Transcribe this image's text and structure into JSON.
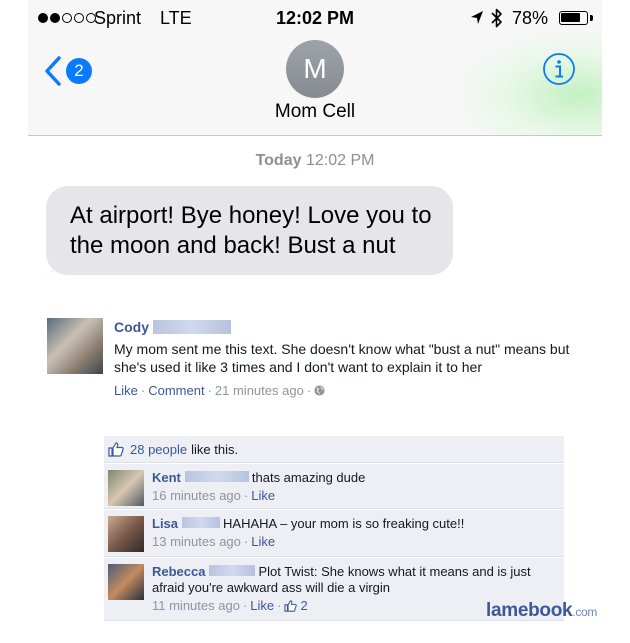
{
  "status_bar": {
    "carrier": "Sprint",
    "network": "LTE",
    "time": "12:02 PM",
    "battery_percent": "78%",
    "battery_level": 0.78,
    "signal_bars_filled": 2,
    "signal_bars_total": 5
  },
  "header": {
    "back_count": "2",
    "contact_initial": "M",
    "contact_name": "Mom Cell",
    "info_icon": "info-icon"
  },
  "thread": {
    "timestamp_day": "Today",
    "timestamp_time": "12:02 PM",
    "message": "At airport! Bye honey! Love you to the moon and back! Bust a nut",
    "bubble_color": "#e5e5ea",
    "accent_color": "#0a7aff"
  },
  "post": {
    "author": "Cody",
    "text": "My mom sent me this text. She doesn't know what \"bust a nut\" means but she's used it like 3 times and I don't want to explain it to her",
    "like_label": "Like",
    "comment_label": "Comment",
    "time_ago": "21 minutes ago",
    "privacy_icon": "globe-icon",
    "likes_link": "28 people",
    "likes_suffix": "like this.",
    "link_color": "#3b5998"
  },
  "comments": [
    {
      "name": "Kent",
      "text": "thats amazing dude",
      "time": "16 minutes ago",
      "like_label": "Like"
    },
    {
      "name": "Lisa",
      "text": "HAHAHA – your mom is so freaking cute!!",
      "time": "13 minutes ago",
      "like_label": "Like"
    },
    {
      "name": "Rebecca",
      "text": "Plot Twist: She knows what it means and is just afraid you're awkward ass will die a virgin",
      "time": "11 minutes ago",
      "like_label": "Like",
      "like_count": "2"
    }
  ],
  "watermark": {
    "brand": "lamebook",
    "tld": ".com"
  }
}
